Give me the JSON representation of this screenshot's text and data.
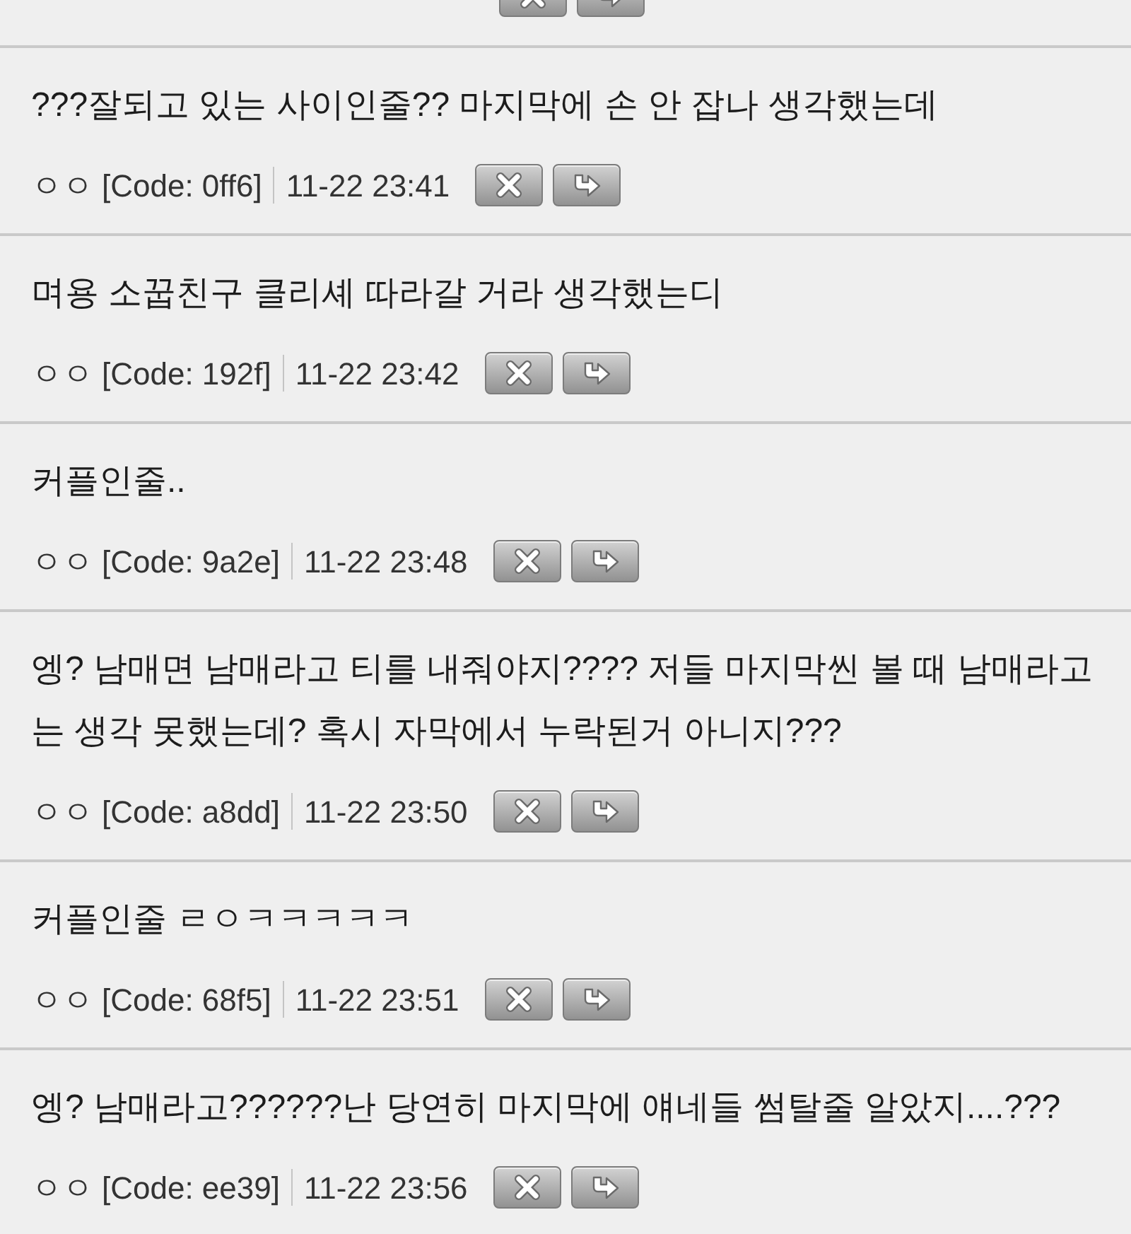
{
  "top_partial": {
    "actions": [
      {
        "kind": "delete"
      },
      {
        "kind": "reply"
      }
    ]
  },
  "comments": [
    {
      "text": "???잘되고 있는 사이인줄?? 마지막에 손 안 잡나 생각했는데",
      "author": "ㅇㅇ",
      "code": "[Code: 0ff6]",
      "time": "11-22 23:41",
      "actions": [
        {
          "kind": "delete"
        },
        {
          "kind": "reply"
        }
      ]
    },
    {
      "text": "며용 소꿉친구 클리셰 따라갈 거라 생각했는디",
      "author": "ㅇㅇ",
      "code": "[Code: 192f]",
      "time": "11-22 23:42",
      "actions": [
        {
          "kind": "delete"
        },
        {
          "kind": "reply"
        }
      ]
    },
    {
      "text": "커플인줄..",
      "author": "ㅇㅇ",
      "code": "[Code: 9a2e]",
      "time": "11-22 23:48",
      "actions": [
        {
          "kind": "delete"
        },
        {
          "kind": "reply"
        }
      ]
    },
    {
      "text": "엥? 남매면 남매라고 티를 내줘야지???? 저들 마지막씬 볼 때 남매라고는 생각 못했는데? 혹시 자막에서 누락된거 아니지???",
      "author": "ㅇㅇ",
      "code": "[Code: a8dd]",
      "time": "11-22 23:50",
      "actions": [
        {
          "kind": "delete"
        },
        {
          "kind": "reply"
        }
      ]
    },
    {
      "text": "커플인줄 ㄹㅇㅋㅋㅋㅋㅋ",
      "author": "ㅇㅇ",
      "code": "[Code: 68f5]",
      "time": "11-22 23:51",
      "actions": [
        {
          "kind": "delete"
        },
        {
          "kind": "reply"
        }
      ]
    },
    {
      "text": "엥? 남매라고??????난 당연히 마지막에 얘네들 썸탈줄 알았지....???",
      "author": "ㅇㅇ",
      "code": "[Code: ee39]",
      "time": "11-22 23:56",
      "actions": [
        {
          "kind": "delete"
        },
        {
          "kind": "reply"
        }
      ]
    }
  ]
}
